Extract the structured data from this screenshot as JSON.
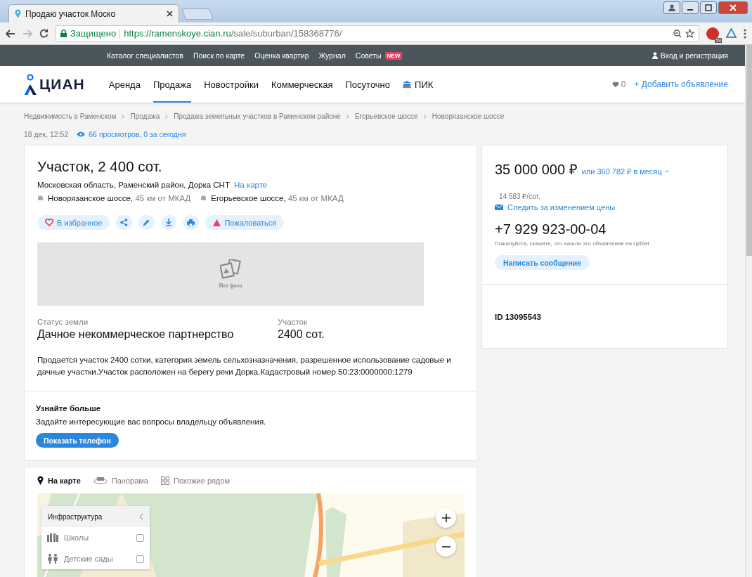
{
  "browser": {
    "tab_title": "Продаю участок Моско",
    "secure_label": "Защищено",
    "url_host": "https://ramenskoye.cian.ru",
    "url_path": "/sale/suburban/158368776/",
    "adblock_badge": "59"
  },
  "top_nav": {
    "items": [
      {
        "label": "Каталог специалистов"
      },
      {
        "label": "Поиск по карте"
      },
      {
        "label": "Оценка квартир"
      },
      {
        "label": "Журнал"
      },
      {
        "label": "Советы",
        "badge": "NEW"
      }
    ],
    "login": "Вход и регистрация"
  },
  "header": {
    "logo": "ЦИАН",
    "nav": [
      {
        "label": "Аренда",
        "selected": false,
        "kind": "plain"
      },
      {
        "label": "Продажа",
        "selected": true,
        "kind": "plain"
      },
      {
        "label": "Новостройки",
        "selected": false,
        "kind": "plain"
      },
      {
        "label": "Коммерческая",
        "selected": false,
        "kind": "plain"
      },
      {
        "label": "Посуточно",
        "selected": false,
        "kind": "plain"
      },
      {
        "label": "ПИК",
        "selected": false,
        "kind": "pik"
      }
    ],
    "favorites_count": "0",
    "add_listing": "+ Добавить объявление"
  },
  "breadcrumbs": [
    "Недвижимость в Раменском",
    "Продажа",
    "Продажа земельных участков в Раменском районе",
    "Егорьевское шоссе",
    "Новорязанское шоссе"
  ],
  "meta": {
    "date": "18 дек, 12:52",
    "views": "66 просмотров, 0 за сегодня"
  },
  "listing": {
    "title": "Участок, 2 400 сот.",
    "address": "Московская область, Раменский район, Дорка СНТ",
    "map_link": "На карте",
    "highways": [
      {
        "name": "Новорязанское шоссе,",
        "distance": "45 км от МКАД"
      },
      {
        "name": "Егорьевское шоссе,",
        "distance": "45 км от МКАД"
      }
    ],
    "actions": [
      {
        "kind": "favorite",
        "label": "В избранное"
      },
      {
        "kind": "share"
      },
      {
        "kind": "edit"
      },
      {
        "kind": "download"
      },
      {
        "kind": "print"
      },
      {
        "kind": "complain",
        "label": "Пожаловаться"
      }
    ],
    "photo_caption": "Нет фото",
    "facts": [
      {
        "label": "Статус земли",
        "value": "Дачное некоммерческое партнерство"
      },
      {
        "label": "Участок",
        "value": "2400 сот."
      }
    ],
    "description": "Продается участок 2400 сотки, категория земель сельхозназначения, разрешенное использование садовые и дачные участки.Участок расположен на берегу реки Дорка.Кадастровый номер 50:23:0000000:1279"
  },
  "contact_more": {
    "title": "Узнайте больше",
    "text": "Задайте интересующие вас вопросы владельцу объявления.",
    "button": "Показать телефон"
  },
  "price": {
    "price": "35 000 000 ₽",
    "monthly": "или 360 782 ₽ в месяц",
    "per_unit": "14 583 ₽/сот.",
    "watch": "Следить за изменением цены",
    "phone": "+7 929 923-00-04",
    "hint": "Пожалуйста, скажите, что нашли это объявление на ЦИАН",
    "message_button": "Написать сообщение",
    "id": "ID 13095543"
  },
  "map": {
    "tabs": [
      {
        "kind": "map",
        "label": "На карте",
        "selected": true
      },
      {
        "kind": "panorama",
        "label": "Панорама",
        "selected": false
      },
      {
        "kind": "nearby",
        "label": "Похожие рядом",
        "selected": false
      }
    ],
    "infrastructure": {
      "title": "Инфраструктура",
      "items": [
        {
          "kind": "schools",
          "label": "Школы",
          "checked": false
        },
        {
          "kind": "kindergartens",
          "label": "Детские сады",
          "checked": false
        }
      ]
    }
  }
}
